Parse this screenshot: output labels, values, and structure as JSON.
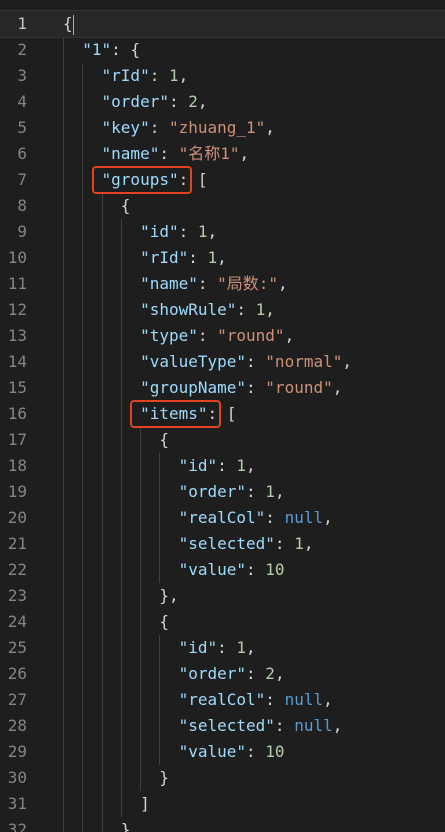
{
  "lines": [
    {
      "num": "1",
      "tokens": [
        {
          "t": "{",
          "c": "p"
        }
      ]
    },
    {
      "num": "2",
      "tokens": [
        {
          "t": "  ",
          "c": "p"
        },
        {
          "t": "\"1\"",
          "c": "k"
        },
        {
          "t": ": {",
          "c": "p"
        }
      ]
    },
    {
      "num": "3",
      "tokens": [
        {
          "t": "    ",
          "c": "p"
        },
        {
          "t": "\"rId\"",
          "c": "k"
        },
        {
          "t": ": ",
          "c": "p"
        },
        {
          "t": "1",
          "c": "n"
        },
        {
          "t": ",",
          "c": "p"
        }
      ]
    },
    {
      "num": "4",
      "tokens": [
        {
          "t": "    ",
          "c": "p"
        },
        {
          "t": "\"order\"",
          "c": "k"
        },
        {
          "t": ": ",
          "c": "p"
        },
        {
          "t": "2",
          "c": "n"
        },
        {
          "t": ",",
          "c": "p"
        }
      ]
    },
    {
      "num": "5",
      "tokens": [
        {
          "t": "    ",
          "c": "p"
        },
        {
          "t": "\"key\"",
          "c": "k"
        },
        {
          "t": ": ",
          "c": "p"
        },
        {
          "t": "\"zhuang_1\"",
          "c": "s"
        },
        {
          "t": ",",
          "c": "p"
        }
      ]
    },
    {
      "num": "6",
      "tokens": [
        {
          "t": "    ",
          "c": "p"
        },
        {
          "t": "\"name\"",
          "c": "k"
        },
        {
          "t": ": ",
          "c": "p"
        },
        {
          "t": "\"名称1\"",
          "c": "s"
        },
        {
          "t": ",",
          "c": "p"
        }
      ]
    },
    {
      "num": "7",
      "tokens": [
        {
          "t": "    ",
          "c": "p"
        },
        {
          "t": "\"groups\"",
          "c": "k"
        },
        {
          "t": ": [",
          "c": "p"
        }
      ]
    },
    {
      "num": "8",
      "tokens": [
        {
          "t": "      {",
          "c": "p"
        }
      ]
    },
    {
      "num": "9",
      "tokens": [
        {
          "t": "        ",
          "c": "p"
        },
        {
          "t": "\"id\"",
          "c": "k"
        },
        {
          "t": ": ",
          "c": "p"
        },
        {
          "t": "1",
          "c": "n"
        },
        {
          "t": ",",
          "c": "p"
        }
      ]
    },
    {
      "num": "10",
      "tokens": [
        {
          "t": "        ",
          "c": "p"
        },
        {
          "t": "\"rId\"",
          "c": "k"
        },
        {
          "t": ": ",
          "c": "p"
        },
        {
          "t": "1",
          "c": "n"
        },
        {
          "t": ",",
          "c": "p"
        }
      ]
    },
    {
      "num": "11",
      "tokens": [
        {
          "t": "        ",
          "c": "p"
        },
        {
          "t": "\"name\"",
          "c": "k"
        },
        {
          "t": ": ",
          "c": "p"
        },
        {
          "t": "\"局数:\"",
          "c": "s"
        },
        {
          "t": ",",
          "c": "p"
        }
      ]
    },
    {
      "num": "12",
      "tokens": [
        {
          "t": "        ",
          "c": "p"
        },
        {
          "t": "\"showRule\"",
          "c": "k"
        },
        {
          "t": ": ",
          "c": "p"
        },
        {
          "t": "1",
          "c": "n"
        },
        {
          "t": ",",
          "c": "p"
        }
      ]
    },
    {
      "num": "13",
      "tokens": [
        {
          "t": "        ",
          "c": "p"
        },
        {
          "t": "\"type\"",
          "c": "k"
        },
        {
          "t": ": ",
          "c": "p"
        },
        {
          "t": "\"round\"",
          "c": "s"
        },
        {
          "t": ",",
          "c": "p"
        }
      ]
    },
    {
      "num": "14",
      "tokens": [
        {
          "t": "        ",
          "c": "p"
        },
        {
          "t": "\"valueType\"",
          "c": "k"
        },
        {
          "t": ": ",
          "c": "p"
        },
        {
          "t": "\"normal\"",
          "c": "s"
        },
        {
          "t": ",",
          "c": "p"
        }
      ]
    },
    {
      "num": "15",
      "tokens": [
        {
          "t": "        ",
          "c": "p"
        },
        {
          "t": "\"groupName\"",
          "c": "k"
        },
        {
          "t": ": ",
          "c": "p"
        },
        {
          "t": "\"round\"",
          "c": "s"
        },
        {
          "t": ",",
          "c": "p"
        }
      ]
    },
    {
      "num": "16",
      "tokens": [
        {
          "t": "        ",
          "c": "p"
        },
        {
          "t": "\"items\"",
          "c": "k"
        },
        {
          "t": ": [",
          "c": "p"
        }
      ]
    },
    {
      "num": "17",
      "tokens": [
        {
          "t": "          {",
          "c": "p"
        }
      ]
    },
    {
      "num": "18",
      "tokens": [
        {
          "t": "            ",
          "c": "p"
        },
        {
          "t": "\"id\"",
          "c": "k"
        },
        {
          "t": ": ",
          "c": "p"
        },
        {
          "t": "1",
          "c": "n"
        },
        {
          "t": ",",
          "c": "p"
        }
      ]
    },
    {
      "num": "19",
      "tokens": [
        {
          "t": "            ",
          "c": "p"
        },
        {
          "t": "\"order\"",
          "c": "k"
        },
        {
          "t": ": ",
          "c": "p"
        },
        {
          "t": "1",
          "c": "n"
        },
        {
          "t": ",",
          "c": "p"
        }
      ]
    },
    {
      "num": "20",
      "tokens": [
        {
          "t": "            ",
          "c": "p"
        },
        {
          "t": "\"realCol\"",
          "c": "k"
        },
        {
          "t": ": ",
          "c": "p"
        },
        {
          "t": "null",
          "c": "kw"
        },
        {
          "t": ",",
          "c": "p"
        }
      ]
    },
    {
      "num": "21",
      "tokens": [
        {
          "t": "            ",
          "c": "p"
        },
        {
          "t": "\"selected\"",
          "c": "k"
        },
        {
          "t": ": ",
          "c": "p"
        },
        {
          "t": "1",
          "c": "n"
        },
        {
          "t": ",",
          "c": "p"
        }
      ]
    },
    {
      "num": "22",
      "tokens": [
        {
          "t": "            ",
          "c": "p"
        },
        {
          "t": "\"value\"",
          "c": "k"
        },
        {
          "t": ": ",
          "c": "p"
        },
        {
          "t": "10",
          "c": "n"
        }
      ]
    },
    {
      "num": "23",
      "tokens": [
        {
          "t": "          },",
          "c": "p"
        }
      ]
    },
    {
      "num": "24",
      "tokens": [
        {
          "t": "          {",
          "c": "p"
        }
      ]
    },
    {
      "num": "25",
      "tokens": [
        {
          "t": "            ",
          "c": "p"
        },
        {
          "t": "\"id\"",
          "c": "k"
        },
        {
          "t": ": ",
          "c": "p"
        },
        {
          "t": "1",
          "c": "n"
        },
        {
          "t": ",",
          "c": "p"
        }
      ]
    },
    {
      "num": "26",
      "tokens": [
        {
          "t": "            ",
          "c": "p"
        },
        {
          "t": "\"order\"",
          "c": "k"
        },
        {
          "t": ": ",
          "c": "p"
        },
        {
          "t": "2",
          "c": "n"
        },
        {
          "t": ",",
          "c": "p"
        }
      ]
    },
    {
      "num": "27",
      "tokens": [
        {
          "t": "            ",
          "c": "p"
        },
        {
          "t": "\"realCol\"",
          "c": "k"
        },
        {
          "t": ": ",
          "c": "p"
        },
        {
          "t": "null",
          "c": "kw"
        },
        {
          "t": ",",
          "c": "p"
        }
      ]
    },
    {
      "num": "28",
      "tokens": [
        {
          "t": "            ",
          "c": "p"
        },
        {
          "t": "\"selected\"",
          "c": "k"
        },
        {
          "t": ": ",
          "c": "p"
        },
        {
          "t": "null",
          "c": "kw"
        },
        {
          "t": ",",
          "c": "p"
        }
      ]
    },
    {
      "num": "29",
      "tokens": [
        {
          "t": "            ",
          "c": "p"
        },
        {
          "t": "\"value\"",
          "c": "k"
        },
        {
          "t": ": ",
          "c": "p"
        },
        {
          "t": "10",
          "c": "n"
        }
      ]
    },
    {
      "num": "30",
      "tokens": [
        {
          "t": "          }",
          "c": "p"
        }
      ]
    },
    {
      "num": "31",
      "tokens": [
        {
          "t": "        ]",
          "c": "p"
        }
      ]
    },
    {
      "num": "32",
      "tokens": [
        {
          "t": "      },",
          "c": "p"
        }
      ]
    }
  ],
  "current_line": "1",
  "highlighted_keys": [
    "\"groups\"",
    "\"items\""
  ],
  "colors": {
    "background": "#1e1e1e",
    "line_number": "#858585",
    "key": "#9cdcfe",
    "string": "#ce9178",
    "number": "#b5cea8",
    "keyword": "#569cd6",
    "punctuation": "#d4d4d4",
    "highlight_box": "#e0451f"
  }
}
